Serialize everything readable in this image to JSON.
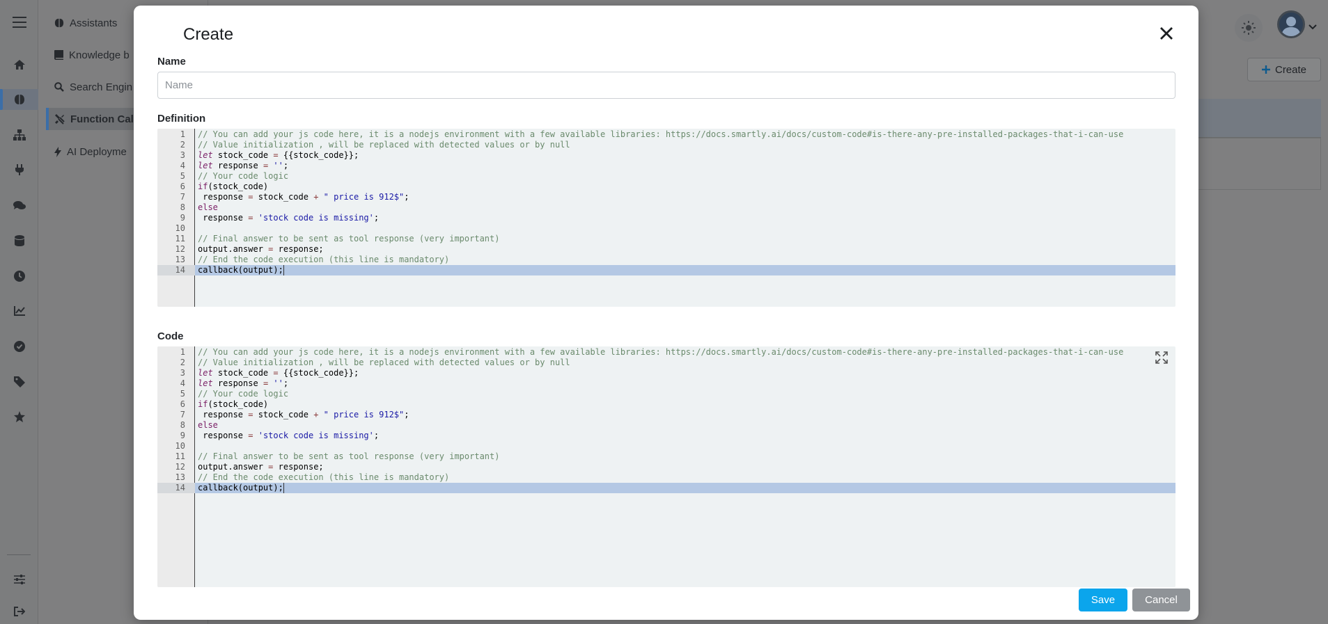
{
  "background": {
    "subnav": {
      "items": [
        {
          "label": "Assistants",
          "icon": "brain-icon"
        },
        {
          "label": "Knowledge b",
          "icon": "book-icon"
        },
        {
          "label": "Search Engin",
          "icon": "search-icon"
        },
        {
          "label": "Function Cal",
          "icon": "tools-icon",
          "active": true
        },
        {
          "label": "AI Deployme",
          "icon": "bolt-icon"
        }
      ]
    },
    "create_label": "Create"
  },
  "modal": {
    "title": "Create",
    "name_label": "Name",
    "name_placeholder": "Name",
    "name_value": "",
    "definition_label": "Definition",
    "code_label": "Code",
    "save_label": "Save",
    "cancel_label": "Cancel"
  },
  "code_lines": [
    "// You can add your js code here, it is a nodejs environment with a few available libraries: https://docs.smartly.ai/docs/custom-code#is-there-any-pre-installed-packages-that-i-can-use",
    "// Value initialization , will be replaced with detected values or by null",
    "let stock_code = {{stock_code}};",
    "let response = '';",
    "// Your code logic",
    "if(stock_code)",
    " response = stock_code + \" price is 912$\";",
    "else",
    " response = 'stock code is missing';",
    "",
    "// Final answer to be sent as tool response (very important)",
    "output.answer = response;",
    "// End the code execution (this line is mandatory)",
    "callback(output);"
  ],
  "colors": {
    "primary": "#0ba5ec",
    "cancel": "#8f9397",
    "highlight_line": "#b4c8e4",
    "editor_bg": "#eef2f3"
  }
}
